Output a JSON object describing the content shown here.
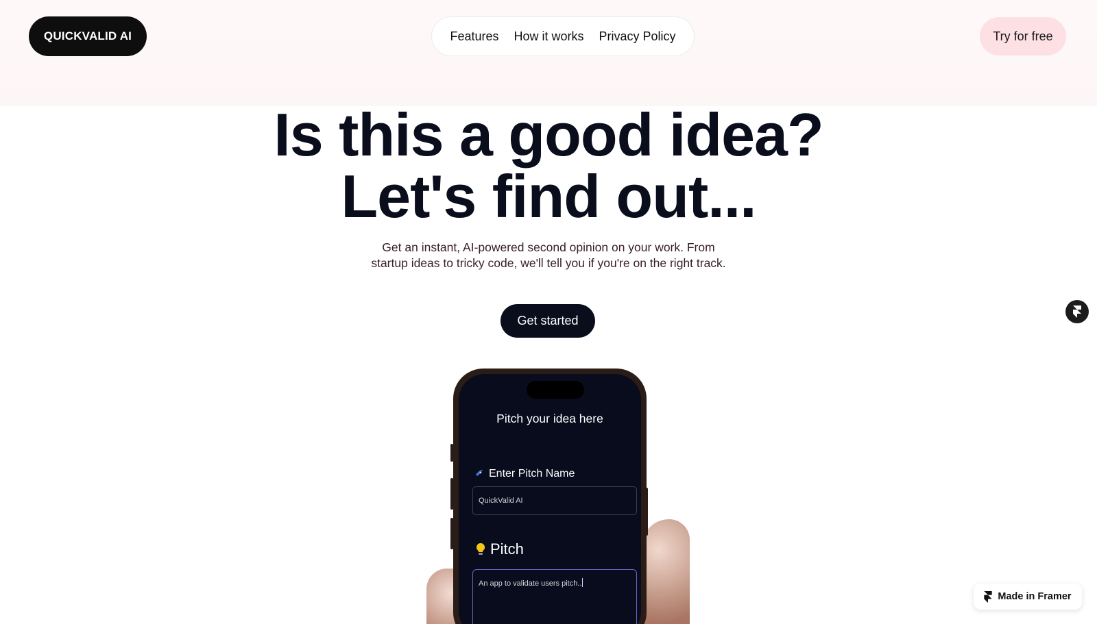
{
  "header": {
    "logo_text": "QUICKVALID AI",
    "nav": [
      "Features",
      "How it works",
      "Privacy Policy"
    ],
    "cta_label": "Try for free"
  },
  "hero": {
    "headline_line1": "Is this a good idea?",
    "headline_line2": "Let's find out...",
    "subtext": "Get an instant, AI-powered second opinion on your work. From startup ideas to tricky code, we'll tell you if you're on the right track.",
    "button_label": "Get started"
  },
  "phone": {
    "title": "Pitch your idea here",
    "name_label": "Enter Pitch Name",
    "name_icon": "rocket-icon",
    "name_value": "QuickValid AI",
    "pitch_label": "Pitch",
    "pitch_icon": "lightbulb-icon",
    "pitch_value": "An app to validate users pitch.."
  },
  "framer_badge": {
    "label": "Made in Framer",
    "icon": "framer-icon"
  },
  "floating_button": {
    "icon": "framer-icon"
  }
}
